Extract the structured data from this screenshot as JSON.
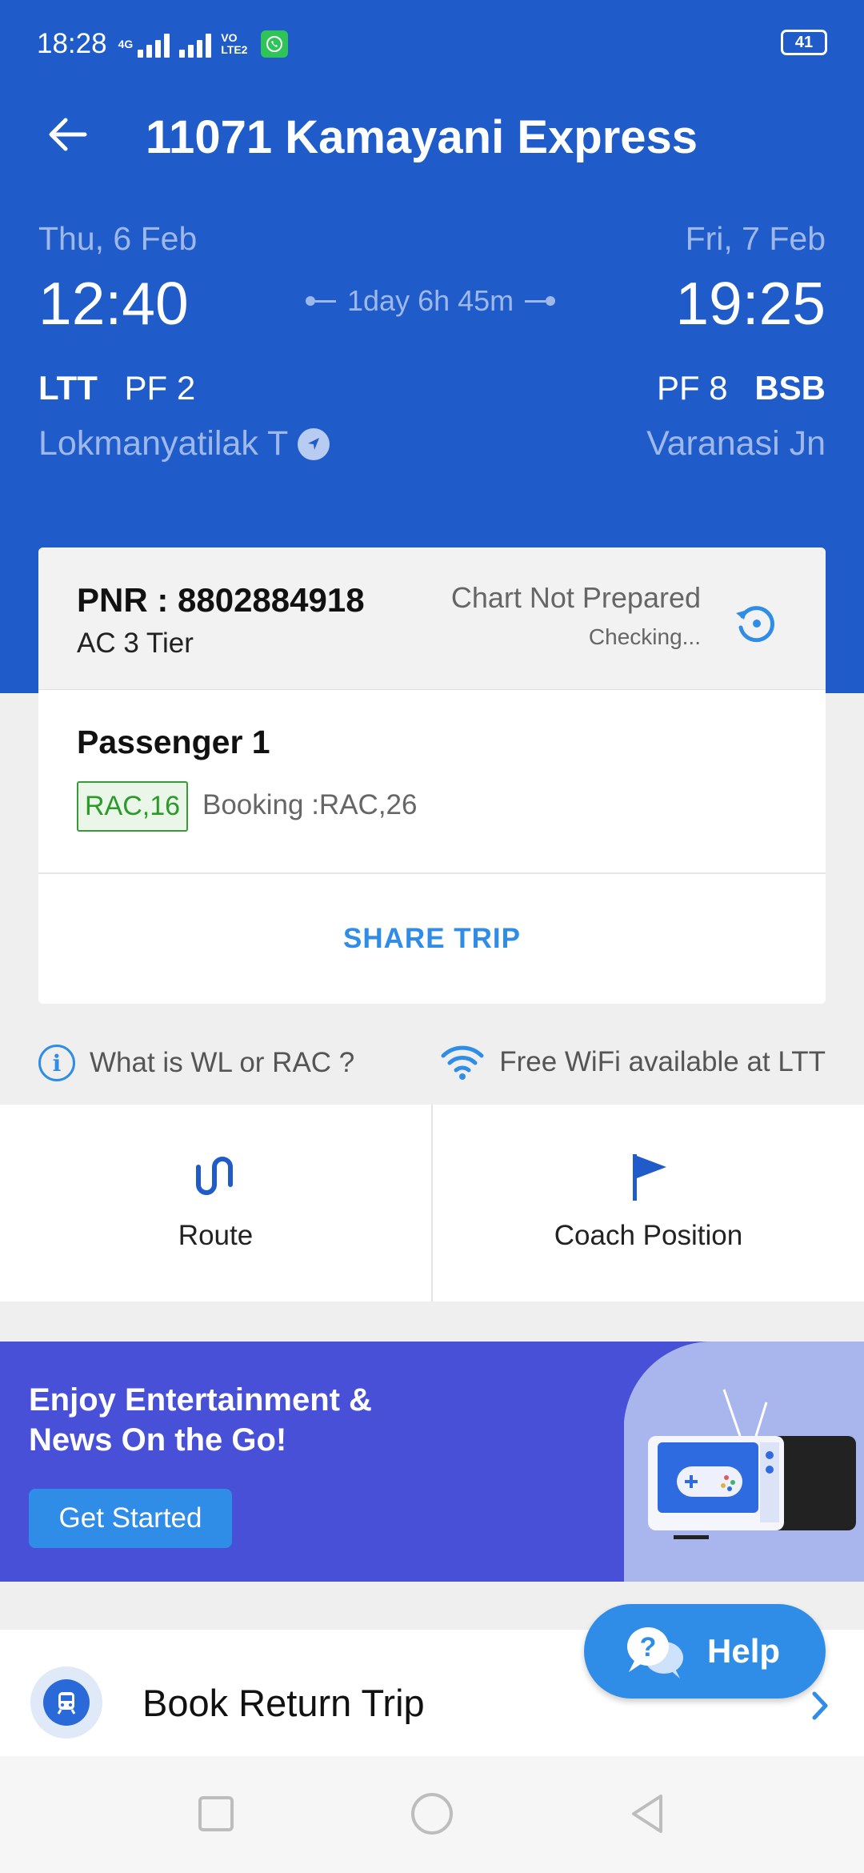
{
  "status_bar": {
    "time": "18:28",
    "network": "4G",
    "volte": "VO LTE2",
    "battery": "41",
    "whatsapp_color": "#2ec457"
  },
  "header": {
    "title": "11071 Kamayani Express",
    "back_icon": "arrow-left-icon",
    "background": "#1f5cc9"
  },
  "journey": {
    "departure": {
      "date": "Thu, 6 Feb",
      "time": "12:40",
      "code": "LTT",
      "platform": "PF 2",
      "station": "Lokmanyatilak T"
    },
    "duration": "1day 6h 45m",
    "arrival": {
      "date": "Fri, 7 Feb",
      "time": "19:25",
      "code": "BSB",
      "platform": "PF 8",
      "station": "Varanasi Jn"
    }
  },
  "booking_card": {
    "pnr": "PNR : 8802884918",
    "class": "AC 3 Tier",
    "chart_status": "Chart Not Prepared",
    "checking": "Checking...",
    "passenger": "Passenger 1",
    "current_status": "RAC,16",
    "booking_status": "Booking :RAC,26",
    "share_label": "SHARE TRIP"
  },
  "info": {
    "wl_rac": "What is WL or RAC ?",
    "wifi": "Free WiFi available at LTT"
  },
  "tiles": [
    {
      "label": "Route",
      "icon": "route-icon"
    },
    {
      "label": "Coach Position",
      "icon": "flag-icon"
    }
  ],
  "banner": {
    "title": "Enjoy Entertainment & News On the Go!",
    "button": "Get Started"
  },
  "book_return": {
    "label": "Book Return Trip",
    "icon": "train-icon"
  },
  "help": {
    "label": "Help"
  },
  "colors": {
    "accent": "#2f8de8",
    "rac_green": "#2a9a2a",
    "banner": "#4750d6"
  }
}
